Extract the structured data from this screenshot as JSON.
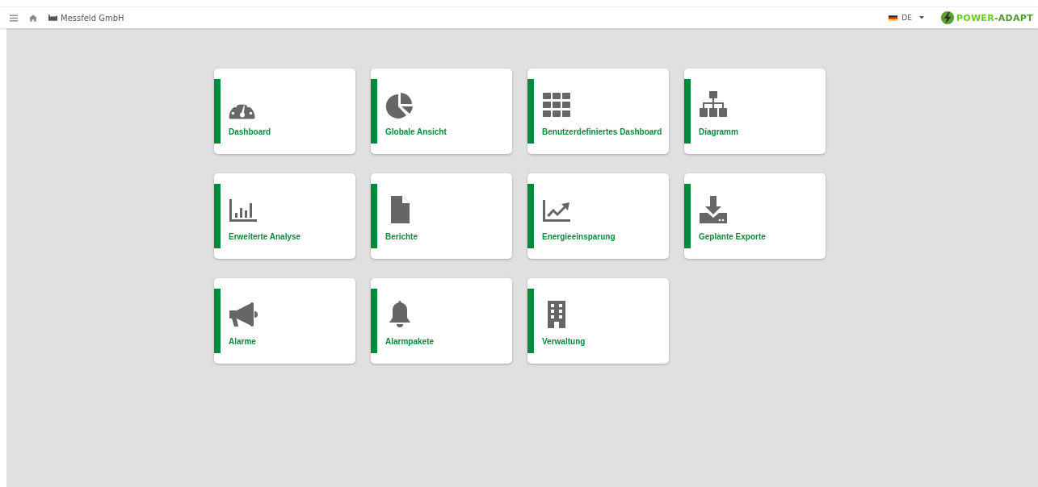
{
  "header": {
    "company": "Messfeld GmbH",
    "language": "DE",
    "logo": {
      "part_1": "POWER",
      "part_2": "-ADAPT"
    }
  },
  "tiles": [
    {
      "label": "Dashboard"
    },
    {
      "label": "Globale Ansicht"
    },
    {
      "label": "Benutzerdefiniertes Dashboard"
    },
    {
      "label": "Diagramm"
    },
    {
      "label": "Erweiterte Analyse"
    },
    {
      "label": "Berichte"
    },
    {
      "label": "Energieeinsparung"
    },
    {
      "label": "Geplante Exporte"
    },
    {
      "label": "Alarme"
    },
    {
      "label": "Alarmpakete"
    },
    {
      "label": "Verwaltung"
    }
  ]
}
